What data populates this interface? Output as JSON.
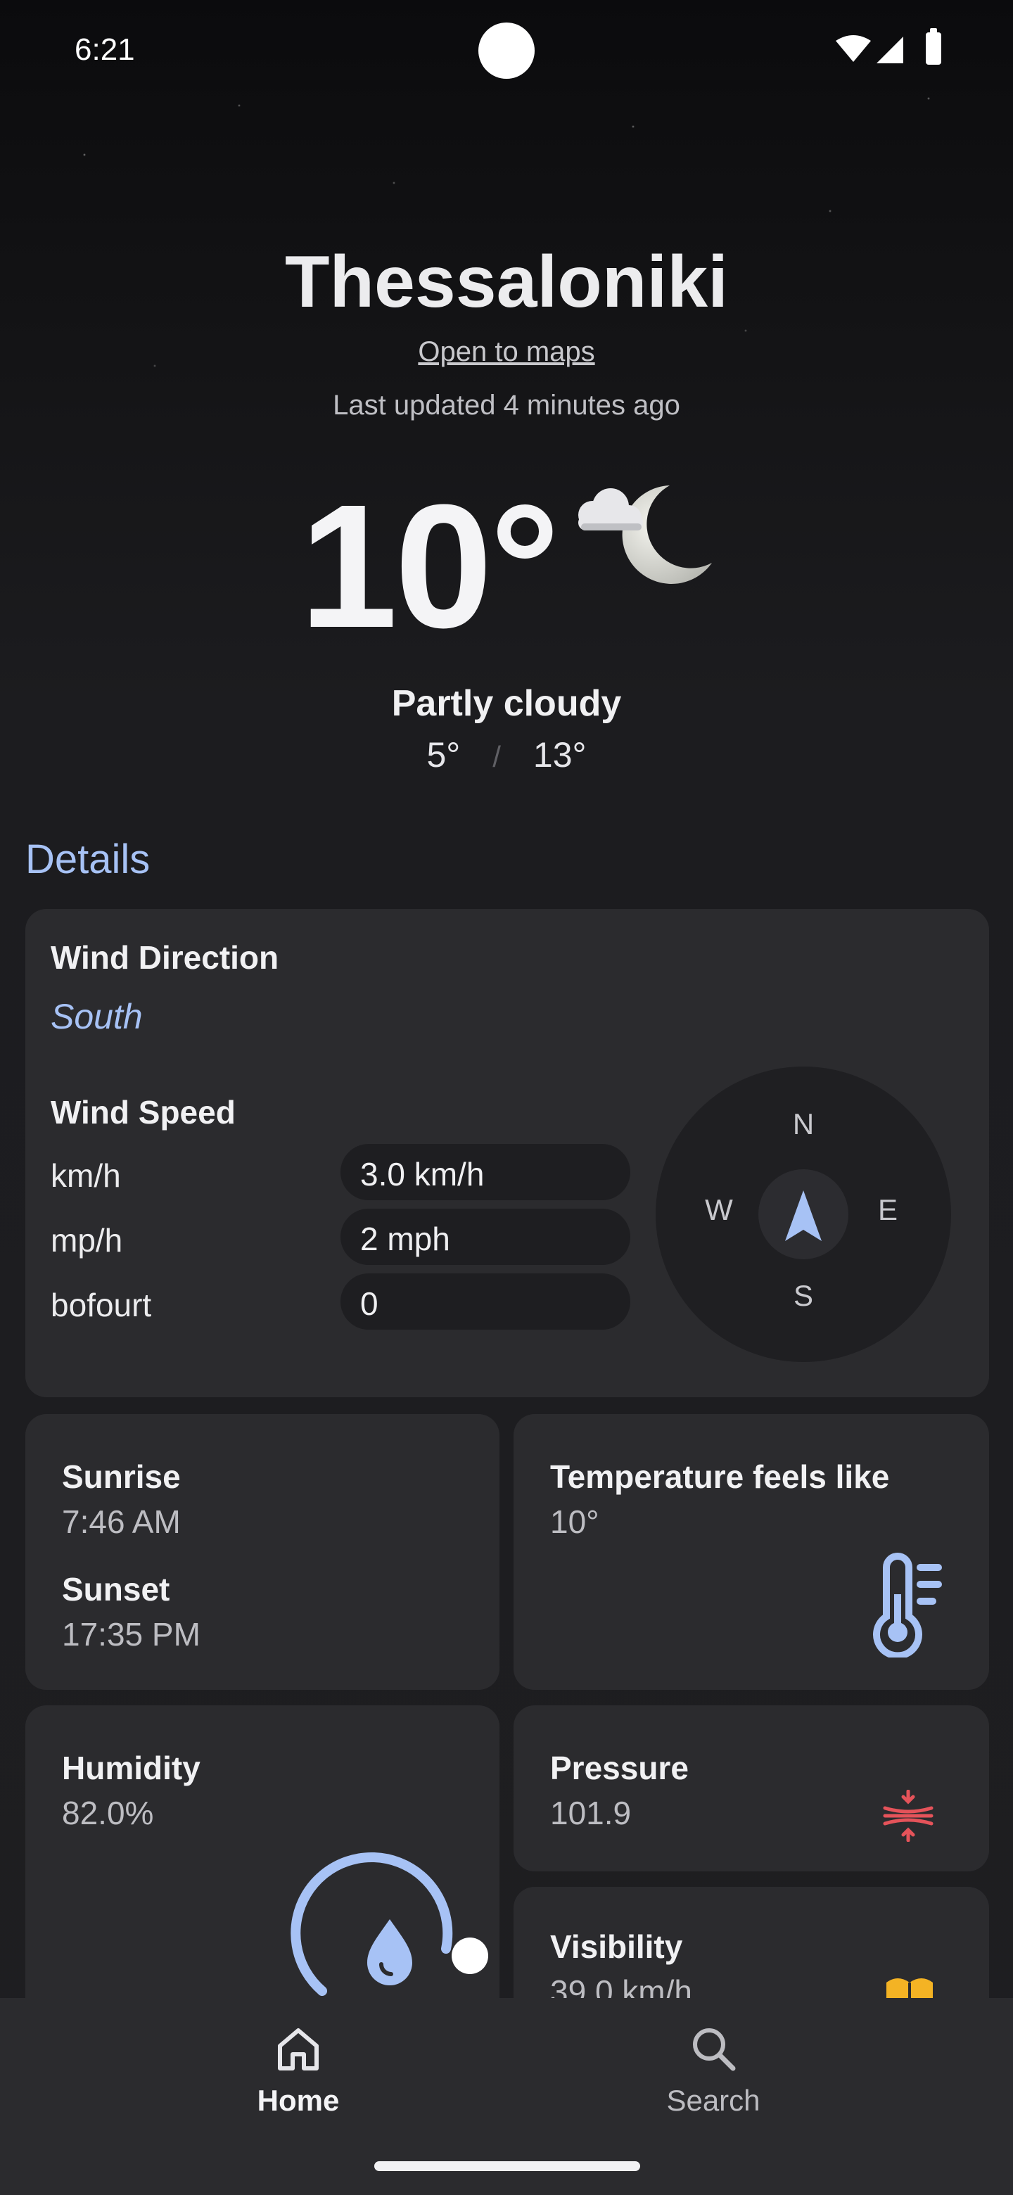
{
  "status_bar": {
    "time": "6:21"
  },
  "header": {
    "city": "Thessaloniki",
    "maps_link": "Open to maps",
    "last_updated": "Last updated 4 minutes ago",
    "temperature": "10°",
    "condition": "Partly cloudy",
    "min_temp": "5°",
    "separator": "/",
    "max_temp": "13°",
    "weather_icon": "cloud-moon-icon"
  },
  "details": {
    "title": "Details",
    "wind": {
      "direction_title": "Wind Direction",
      "direction_value": "South",
      "speed_title": "Wind Speed",
      "rows": [
        {
          "label": "km/h",
          "value": "3.0 km/h"
        },
        {
          "label": "mp/h",
          "value": "2 mph"
        },
        {
          "label": "bofourt",
          "value": "0"
        }
      ],
      "compass": {
        "n": "N",
        "e": "E",
        "s": "S",
        "w": "W"
      }
    },
    "sun": {
      "sunrise_title": "Sunrise",
      "sunrise_value": "7:46 AM",
      "sunset_title": "Sunset",
      "sunset_value": "17:35 PM"
    },
    "feels_like": {
      "title": "Temperature feels like",
      "value": "10°",
      "icon": "thermometer-icon"
    },
    "humidity": {
      "title": "Humidity",
      "value": "82.0%",
      "level": 0.82,
      "icon": "water-drop-icon"
    },
    "pressure": {
      "title": "Pressure",
      "value": "101.9",
      "icon": "compress-icon"
    },
    "visibility": {
      "title": "Visibility",
      "value": "39.0 km/h",
      "icon": "visibility-book-icon"
    }
  },
  "nav": {
    "home_label": "Home",
    "search_label": "Search"
  },
  "colors": {
    "accent": "#a7c2f5",
    "card": "#2b2b2e",
    "pressure_icon": "#e5535a",
    "visibility_icon": "#f4b324"
  }
}
